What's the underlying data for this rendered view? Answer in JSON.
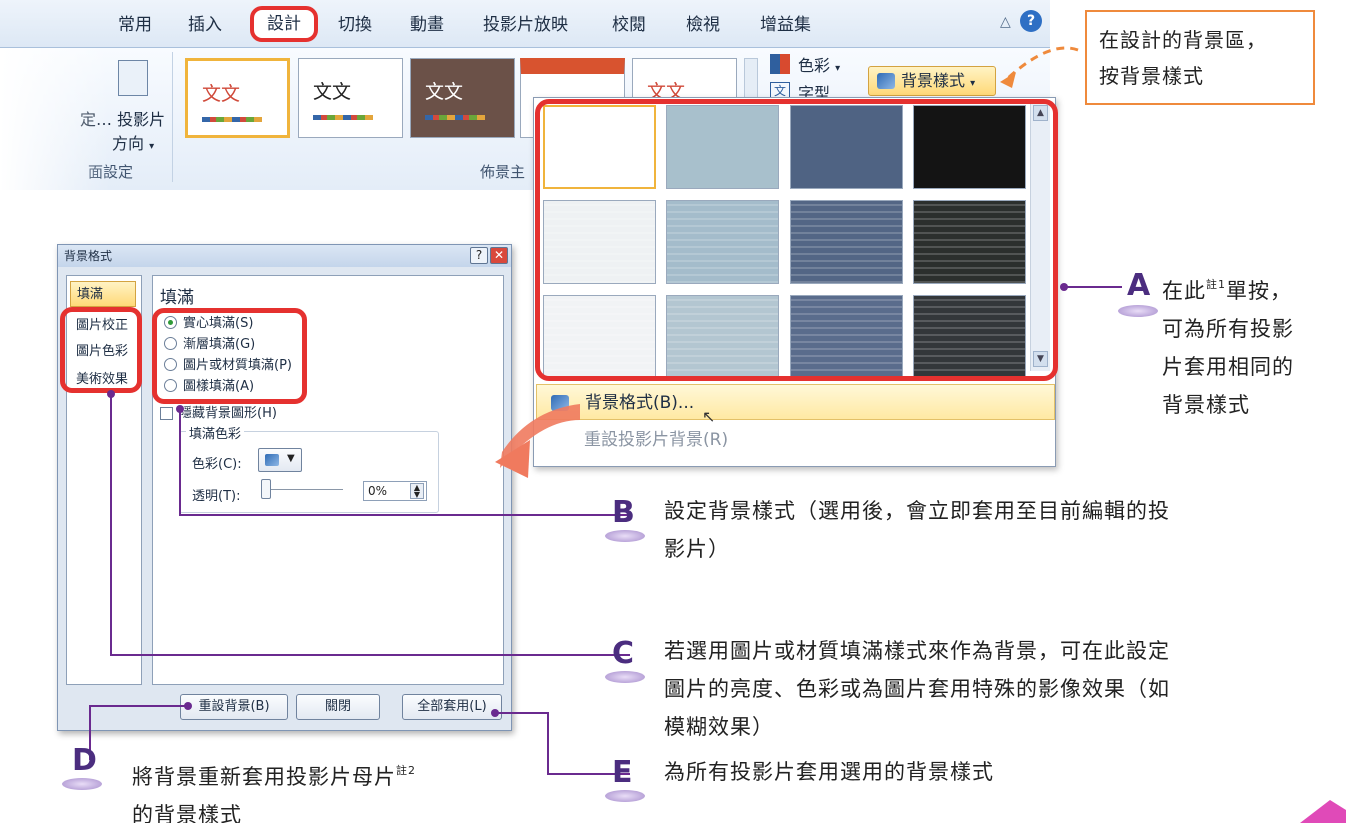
{
  "ribbon": {
    "tabs": [
      "常用",
      "插入",
      "設計",
      "切換",
      "動畫",
      "投影片放映",
      "校閱",
      "檢視",
      "增益集"
    ],
    "active_tab": "設計",
    "orientation_label_1": "定… 投影片",
    "orientation_label_2": "方向",
    "page_setup_label": "面設定",
    "themes_group_label": "佈景主",
    "theme_sample_text": "文文",
    "colors_label": "色彩",
    "fonts_label": "字型",
    "background_styles_button": "背景樣式"
  },
  "gallery": {
    "menu_format": "背景格式(B)...",
    "menu_reset": "重設投影片背景(R)",
    "tile_colors": [
      "#ffffff",
      "#a8c0cc",
      "#4f6383",
      "#141414",
      "#eef1f3",
      "#a4bccb",
      "#536685",
      "#2b2f2d",
      "#f1f3f5",
      "#b3c6d1",
      "#5a6c8c",
      "#33373a"
    ]
  },
  "dialog": {
    "title": "背景格式",
    "nav": [
      "填滿",
      "圖片校正",
      "圖片色彩",
      "美術效果"
    ],
    "panel_heading": "填滿",
    "fill_options": [
      "實心填滿(S)",
      "漸層填滿(G)",
      "圖片或材質填滿(P)",
      "圖樣填滿(A)"
    ],
    "hide_bg_graphics": "隱藏背景圖形(H)",
    "fill_color_group": "填滿色彩",
    "color_label": "色彩(C):",
    "transparency_label": "透明(T):",
    "transparency_value": "0%",
    "buttons": {
      "reset": "重設背景(B)",
      "close": "關閉",
      "apply_all": "全部套用(L)"
    }
  },
  "callout_top": {
    "line1": "在設計的背景區，",
    "line2": "按背景樣式"
  },
  "annotations": {
    "a": {
      "letter": "A",
      "line1": "在此",
      "sup": "註1",
      "line1_rest": "單按，",
      "line2": "可為所有投影",
      "line3": "片套用相同的",
      "line4": "背景樣式"
    },
    "b": {
      "letter": "B",
      "line1": "設定背景樣式（選用後，會立即套用至目前編輯的投",
      "line2": "影片）"
    },
    "c": {
      "letter": "C",
      "line1": "若選用圖片或材質填滿樣式來作為背景，可在此設定",
      "line2": "圖片的亮度、色彩或為圖片套用特殊的影像效果（如",
      "line3": "模糊效果）"
    },
    "d": {
      "letter": "D",
      "line1": "將背景重新套用投影片母片",
      "sup": "註2",
      "line2": "的背景樣式"
    },
    "e": {
      "letter": "E",
      "line1": "為所有投影片套用選用的背景樣式"
    }
  },
  "colors": {
    "highlight_red": "#e5312f",
    "callout_orange": "#ef8a3c",
    "annotation_purple": "#6a2a8f"
  }
}
